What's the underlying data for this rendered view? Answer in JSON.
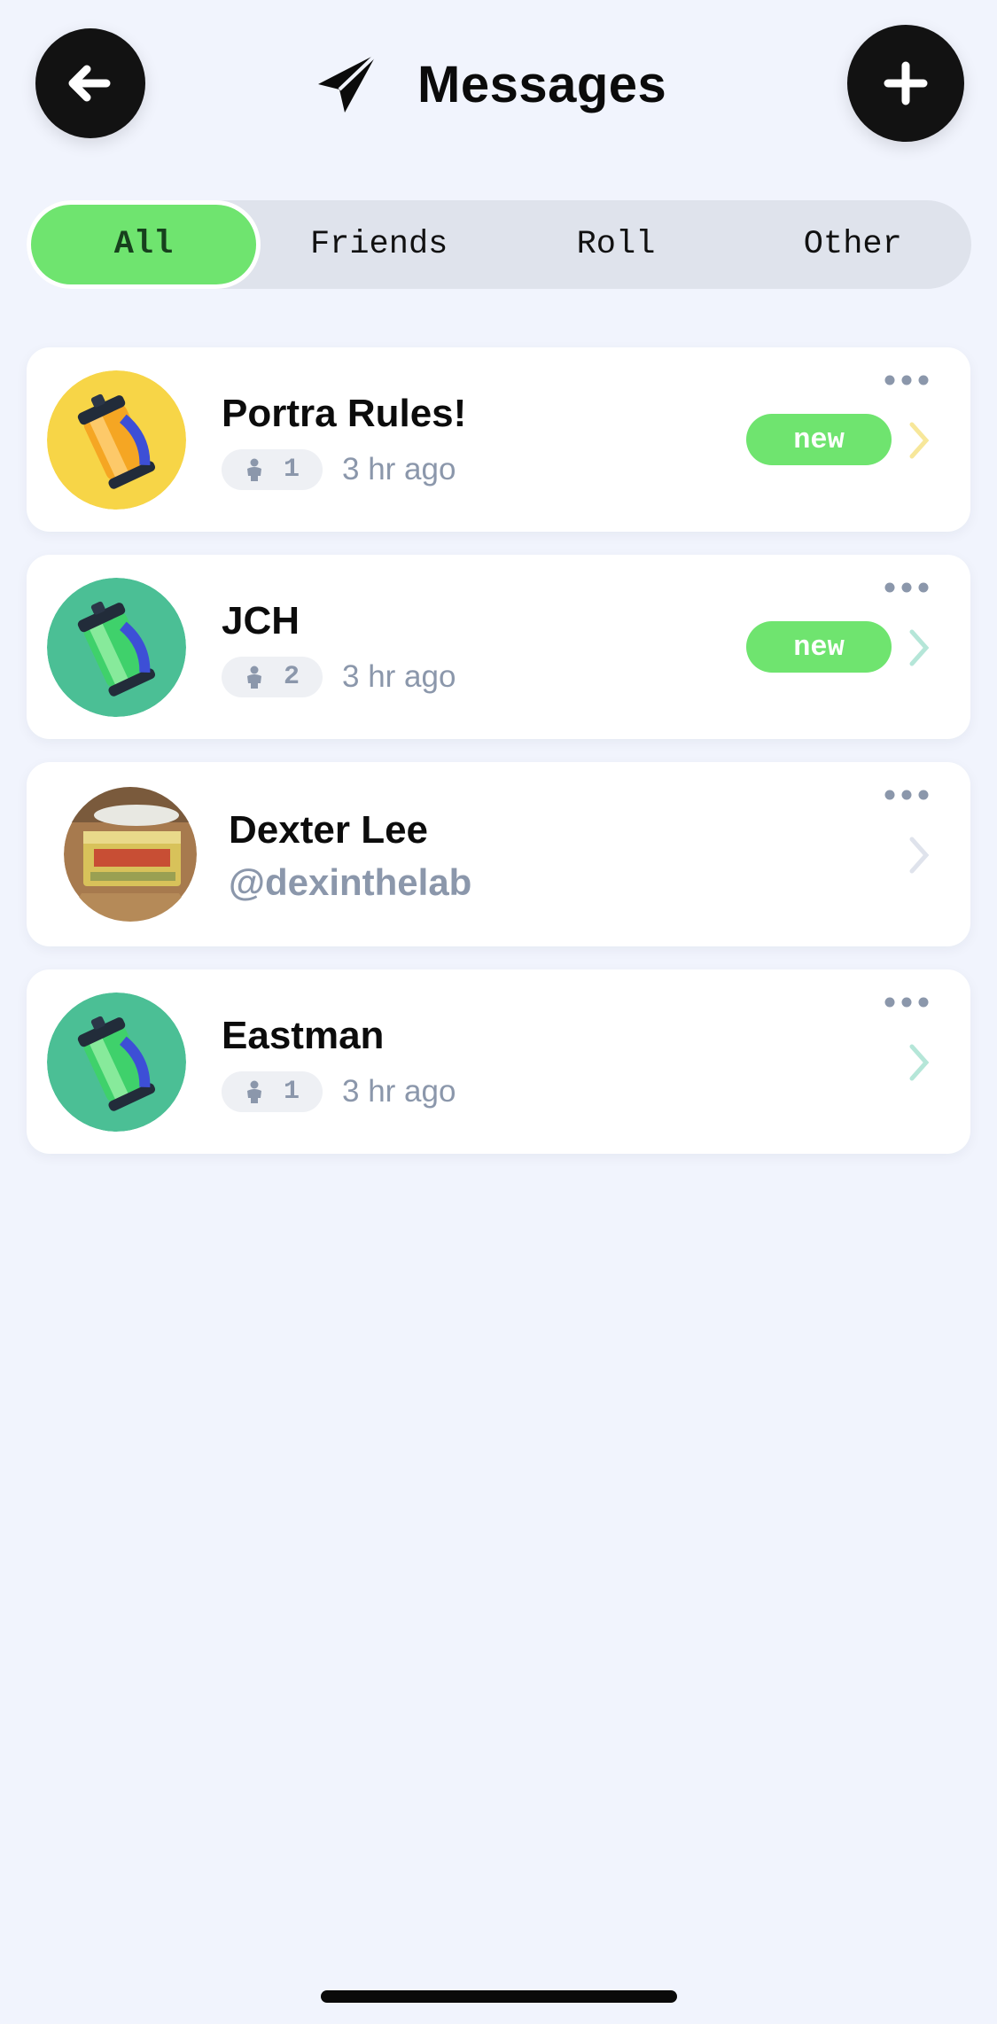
{
  "header": {
    "title": "Messages",
    "back_icon": "arrow-left-icon",
    "add_icon": "plus-icon",
    "title_icon": "paper-plane-icon"
  },
  "tabs": [
    {
      "label": "All",
      "active": true
    },
    {
      "label": "Friends",
      "active": false
    },
    {
      "label": "Roll",
      "active": false
    },
    {
      "label": "Other",
      "active": false
    }
  ],
  "conversations": [
    {
      "name": "Portra Rules!",
      "members": "1",
      "time": "3 hr ago",
      "badge": "new",
      "avatar_color": "#f7d547",
      "chevron_color": "#f7e79a"
    },
    {
      "name": "JCH",
      "members": "2",
      "time": "3 hr ago",
      "badge": "new",
      "avatar_color": "#4bbf95",
      "chevron_color": "#b5e6d8"
    },
    {
      "name": "Dexter Lee",
      "handle": "@dexinthelab",
      "avatar": "butter-photo",
      "chevron_color": "#dfe3ec"
    },
    {
      "name": "Eastman",
      "members": "1",
      "time": "3 hr ago",
      "avatar_color": "#4bbf95",
      "chevron_color": "#b5e6d8"
    }
  ],
  "colors": {
    "background": "#f1f4fd",
    "accent_green": "#6fe46f",
    "muted_text": "#8b97ab"
  }
}
